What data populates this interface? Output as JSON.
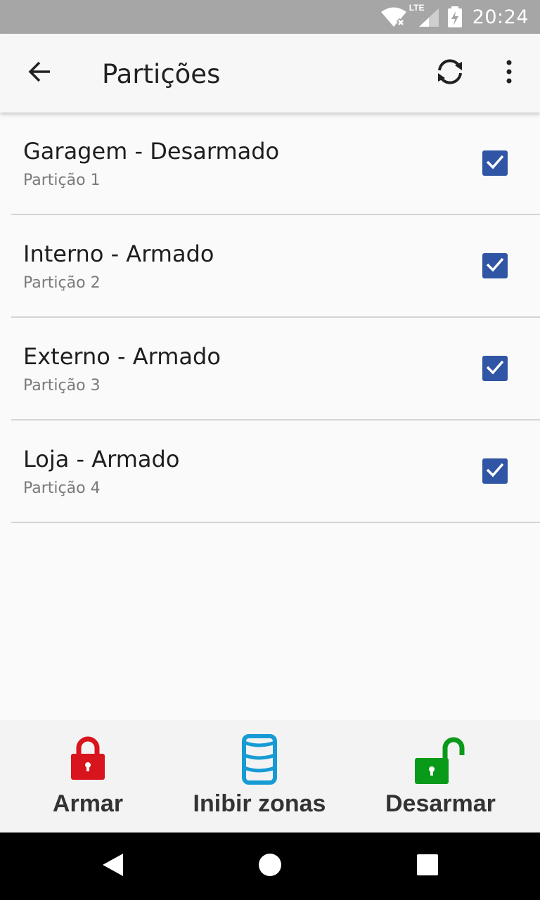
{
  "status_bar": {
    "time": "20:24",
    "network_label": "LTE",
    "icons": [
      "wifi-off-icon",
      "lte-signal-icon",
      "battery-charging-icon"
    ]
  },
  "app_bar": {
    "title": "Partições",
    "back_icon": "arrow-back-icon",
    "sync_icon": "sync-icon",
    "more_icon": "more-vert-icon"
  },
  "partitions": [
    {
      "name": "Garagem - Desarmado",
      "subtitle": "Partição 1",
      "checked": true
    },
    {
      "name": "Interno - Armado",
      "subtitle": "Partição 2",
      "checked": true
    },
    {
      "name": "Externo - Armado",
      "subtitle": "Partição 3",
      "checked": true
    },
    {
      "name": "Loja - Armado",
      "subtitle": "Partição 4",
      "checked": true
    }
  ],
  "actions": {
    "arm": {
      "label": "Armar",
      "icon": "lock-closed-icon",
      "color": "#d8141c"
    },
    "inhibit": {
      "label": "Inibir zonas",
      "icon": "zones-cylinder-icon",
      "color": "#169bd5"
    },
    "disarm": {
      "label": "Desarmar",
      "icon": "lock-open-icon",
      "color": "#0a9a1a"
    }
  },
  "colors": {
    "checkbox": "#2f55a4",
    "status_bar": "#a6a6a6",
    "nav_bar": "#000000"
  }
}
